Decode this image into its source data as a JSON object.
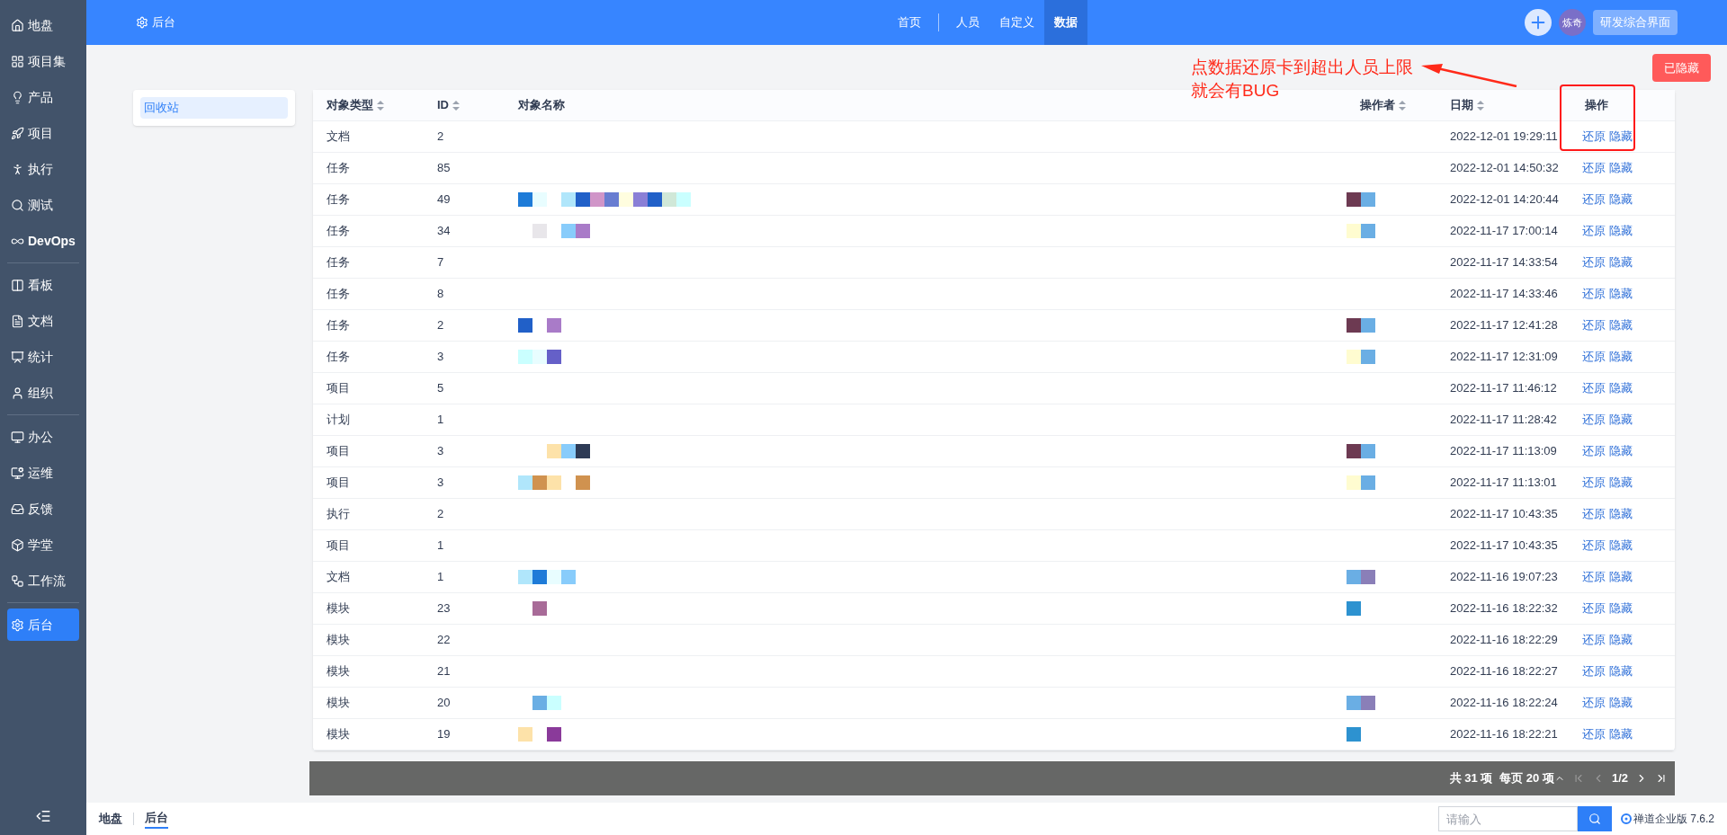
{
  "sidebar": {
    "groups": [
      [
        {
          "label": "地盘",
          "selected": false
        },
        {
          "label": "项目集",
          "selected": false
        },
        {
          "label": "产品",
          "selected": false
        },
        {
          "label": "项目",
          "selected": false
        },
        {
          "label": "执行",
          "selected": false
        },
        {
          "label": "测试",
          "selected": false
        },
        {
          "label": "DevOps",
          "selected": false
        }
      ],
      [
        {
          "label": "看板",
          "selected": false
        },
        {
          "label": "文档",
          "selected": false
        },
        {
          "label": "统计",
          "selected": false
        },
        {
          "label": "组织",
          "selected": false
        }
      ],
      [
        {
          "label": "办公",
          "selected": false
        },
        {
          "label": "运维",
          "selected": false
        },
        {
          "label": "反馈",
          "selected": false
        },
        {
          "label": "学堂",
          "selected": false
        },
        {
          "label": "工作流",
          "selected": false
        }
      ],
      [
        {
          "label": "后台",
          "selected": true
        }
      ]
    ]
  },
  "topbar": {
    "title": "后台",
    "nav": [
      {
        "label": "首页",
        "selected": false
      },
      {
        "label": "人员",
        "selected": false
      },
      {
        "label": "自定义",
        "selected": false
      },
      {
        "label": "数据",
        "selected": true
      }
    ],
    "avatar": "炼奇",
    "workspace": "研发综合界面"
  },
  "side_menu": [
    {
      "label": "回收站",
      "selected": true
    }
  ],
  "hidden_button": "已隐藏",
  "annotation": {
    "lines": [
      "点数据还原卡到超出人员上限",
      "就会有BUG"
    ]
  },
  "table": {
    "columns": [
      {
        "label": "对象类型",
        "sortable": true
      },
      {
        "label": "ID",
        "sortable": true
      },
      {
        "label": "对象名称",
        "sortable": false
      },
      {
        "label": "操作者",
        "sortable": true
      },
      {
        "label": "日期",
        "sortable": true
      },
      {
        "label": "操作",
        "sortable": false
      }
    ],
    "rows": [
      {
        "type": "文档",
        "id": "2",
        "date": "2022-12-01 19:29:11",
        "actions": [
          "还原",
          "隐藏"
        ]
      },
      {
        "type": "任务",
        "id": "85",
        "date": "2022-12-01 14:50:32",
        "actions": [
          "还原",
          "隐藏"
        ]
      },
      {
        "type": "任务",
        "id": "49",
        "date": "2022-12-01 14:20:44",
        "actions": [
          "还原",
          "隐藏"
        ]
      },
      {
        "type": "任务",
        "id": "34",
        "date": "2022-11-17 17:00:14",
        "actions": [
          "还原",
          "隐藏"
        ]
      },
      {
        "type": "任务",
        "id": "7",
        "date": "2022-11-17 14:33:54",
        "actions": [
          "还原",
          "隐藏"
        ]
      },
      {
        "type": "任务",
        "id": "8",
        "date": "2022-11-17 14:33:46",
        "actions": [
          "还原",
          "隐藏"
        ]
      },
      {
        "type": "任务",
        "id": "2",
        "date": "2022-11-17 12:41:28",
        "actions": [
          "还原",
          "隐藏"
        ]
      },
      {
        "type": "任务",
        "id": "3",
        "date": "2022-11-17 12:31:09",
        "actions": [
          "还原",
          "隐藏"
        ]
      },
      {
        "type": "项目",
        "id": "5",
        "date": "2022-11-17 11:46:12",
        "actions": [
          "还原",
          "隐藏"
        ]
      },
      {
        "type": "计划",
        "id": "1",
        "date": "2022-11-17 11:28:42",
        "actions": [
          "还原",
          "隐藏"
        ]
      },
      {
        "type": "项目",
        "id": "3",
        "date": "2022-11-17 11:13:09",
        "actions": [
          "还原",
          "隐藏"
        ]
      },
      {
        "type": "项目",
        "id": "3",
        "date": "2022-11-17 11:13:01",
        "actions": [
          "还原",
          "隐藏"
        ]
      },
      {
        "type": "执行",
        "id": "2",
        "date": "2022-11-17 10:43:35",
        "actions": [
          "还原",
          "隐藏"
        ]
      },
      {
        "type": "项目",
        "id": "1",
        "date": "2022-11-17 10:43:35",
        "actions": [
          "还原",
          "隐藏"
        ]
      },
      {
        "type": "文档",
        "id": "1",
        "date": "2022-11-16 19:07:23",
        "actions": [
          "还原",
          "隐藏"
        ]
      },
      {
        "type": "模块",
        "id": "23",
        "date": "2022-11-16 18:22:32",
        "actions": [
          "还原",
          "隐藏"
        ]
      },
      {
        "type": "模块",
        "id": "22",
        "date": "2022-11-16 18:22:29",
        "actions": [
          "还原",
          "隐藏"
        ]
      },
      {
        "type": "模块",
        "id": "21",
        "date": "2022-11-16 18:22:27",
        "actions": [
          "还原",
          "隐藏"
        ]
      },
      {
        "type": "模块",
        "id": "20",
        "date": "2022-11-16 18:22:24",
        "actions": [
          "还原",
          "隐藏"
        ]
      },
      {
        "type": "模块",
        "id": "19",
        "date": "2022-11-16 18:22:21",
        "actions": [
          "还原",
          "隐藏"
        ]
      }
    ]
  },
  "pagination": {
    "total": "共 31 项",
    "per_page": "每页 20 项",
    "page": "1/2"
  },
  "footer": {
    "breadcrumbs": [
      {
        "label": "地盘",
        "selected": false
      },
      {
        "label": "后台",
        "selected": true
      }
    ],
    "search": {
      "placeholder": "请输入"
    },
    "version": "禅道企业版 7.6.2"
  }
}
